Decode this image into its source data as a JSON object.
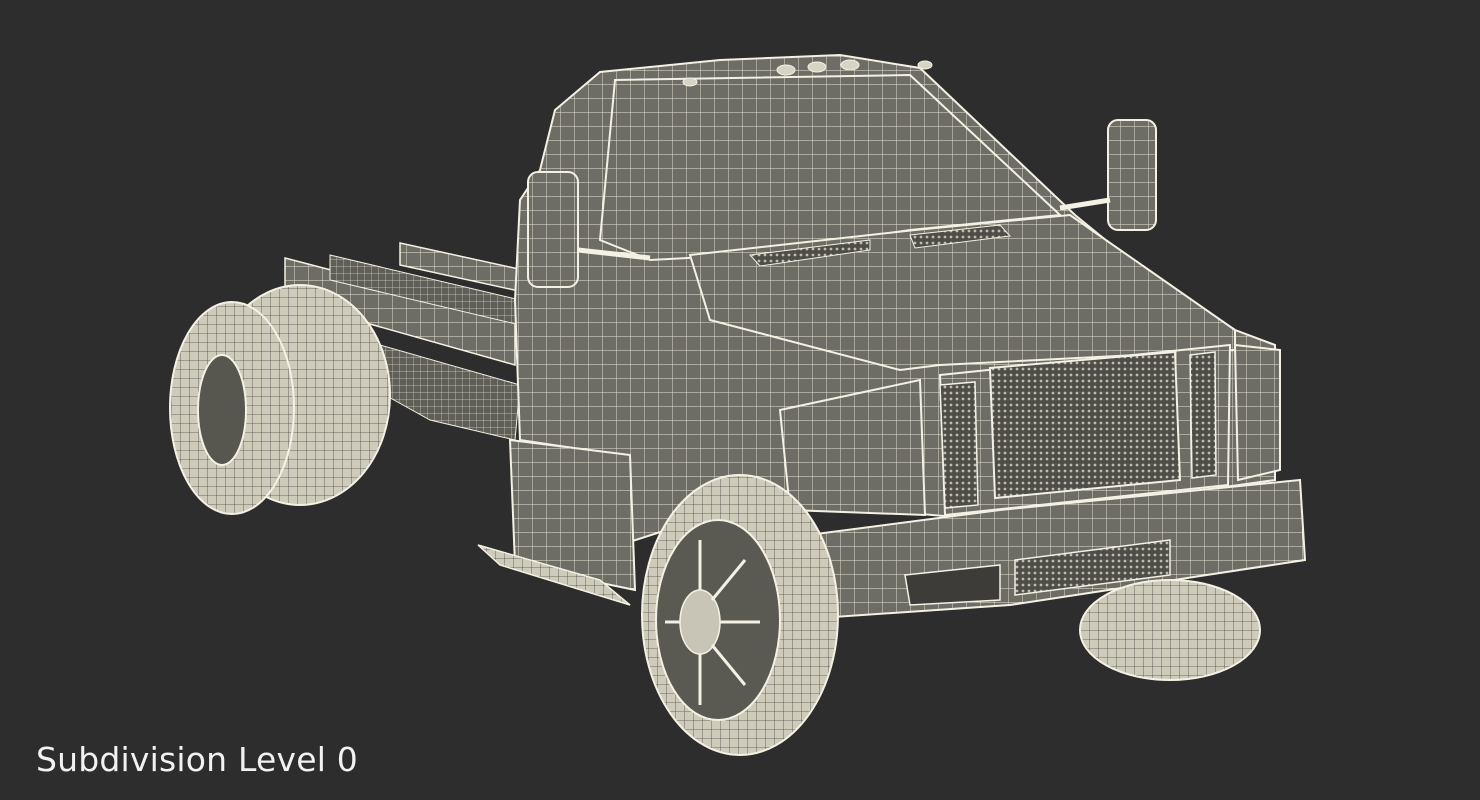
{
  "viewport": {
    "background_color": "#2d2d2d",
    "subject": "truck-chassis-wireframe",
    "render_style": "wireframe",
    "mesh_fill_color": "#6f6e66",
    "wire_color": "#f4f1e4"
  },
  "caption": {
    "text": "Subdivision Level 0"
  }
}
